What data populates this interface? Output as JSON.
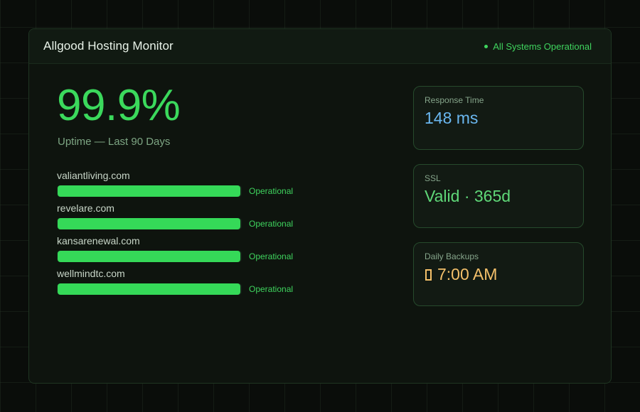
{
  "header": {
    "title": "Allgood Hosting Monitor",
    "status": "All Systems Operational",
    "status_color": "#3fd45e"
  },
  "uptime": {
    "value": "99.9%",
    "label": "Uptime — Last 90 Days"
  },
  "sites": [
    {
      "name": "valiantliving.com",
      "status": "Operational",
      "uptime_fraction": 0.99
    },
    {
      "name": "revelare.com",
      "status": "Operational",
      "uptime_fraction": 0.99
    },
    {
      "name": "kansarenewal.com",
      "status": "Operational",
      "uptime_fraction": 0.99
    },
    {
      "name": "wellmindtc.com",
      "status": "Operational",
      "uptime_fraction": 0.99
    }
  ],
  "stats": {
    "response": {
      "label": "Response Time",
      "value": "148 ms"
    },
    "ssl": {
      "label": "SSL",
      "value": "Valid · 365d"
    },
    "backups": {
      "label": "Daily Backups",
      "value": "7:00 AM",
      "icon": "clock-icon"
    }
  },
  "colors": {
    "accent": "#3bd95c",
    "response": "#6ab7f0",
    "ssl": "#5fd878",
    "backups": "#f4c06a"
  }
}
